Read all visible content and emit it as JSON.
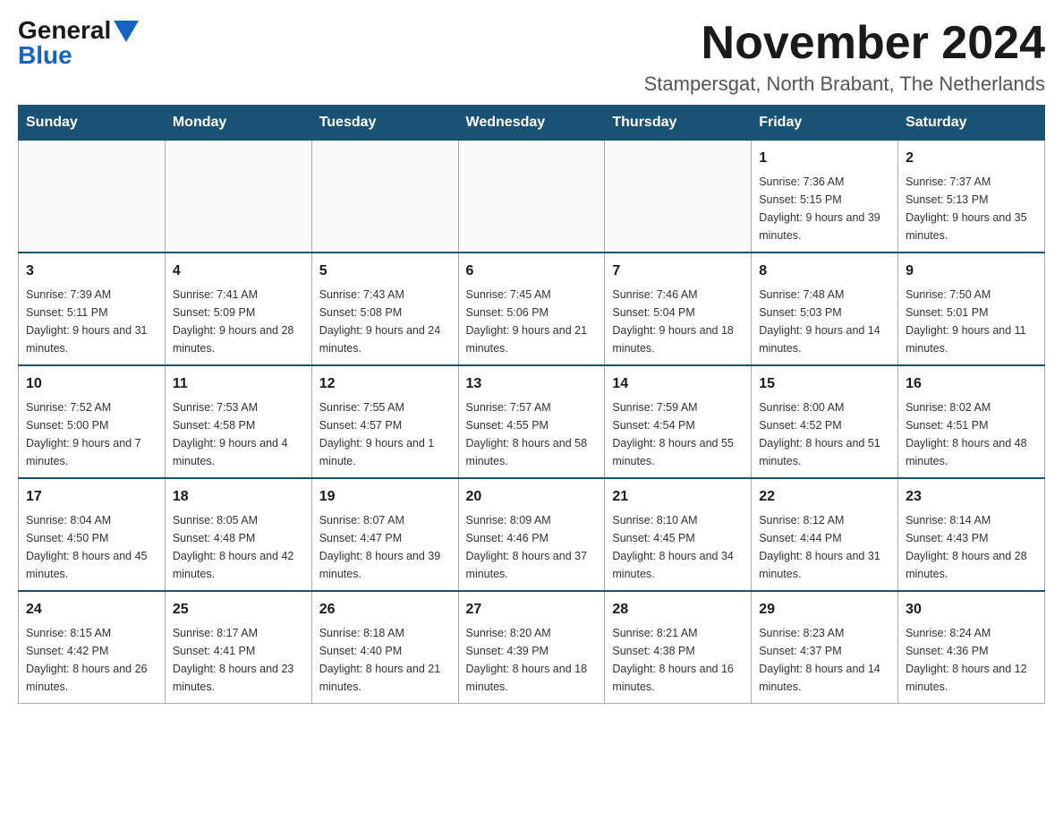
{
  "logo": {
    "general": "General",
    "blue": "Blue"
  },
  "title": "November 2024",
  "location": "Stampersgat, North Brabant, The Netherlands",
  "days_of_week": [
    "Sunday",
    "Monday",
    "Tuesday",
    "Wednesday",
    "Thursday",
    "Friday",
    "Saturday"
  ],
  "weeks": [
    [
      {
        "day": "",
        "sunrise": "",
        "sunset": "",
        "daylight": ""
      },
      {
        "day": "",
        "sunrise": "",
        "sunset": "",
        "daylight": ""
      },
      {
        "day": "",
        "sunrise": "",
        "sunset": "",
        "daylight": ""
      },
      {
        "day": "",
        "sunrise": "",
        "sunset": "",
        "daylight": ""
      },
      {
        "day": "",
        "sunrise": "",
        "sunset": "",
        "daylight": ""
      },
      {
        "day": "1",
        "sunrise": "Sunrise: 7:36 AM",
        "sunset": "Sunset: 5:15 PM",
        "daylight": "Daylight: 9 hours and 39 minutes."
      },
      {
        "day": "2",
        "sunrise": "Sunrise: 7:37 AM",
        "sunset": "Sunset: 5:13 PM",
        "daylight": "Daylight: 9 hours and 35 minutes."
      }
    ],
    [
      {
        "day": "3",
        "sunrise": "Sunrise: 7:39 AM",
        "sunset": "Sunset: 5:11 PM",
        "daylight": "Daylight: 9 hours and 31 minutes."
      },
      {
        "day": "4",
        "sunrise": "Sunrise: 7:41 AM",
        "sunset": "Sunset: 5:09 PM",
        "daylight": "Daylight: 9 hours and 28 minutes."
      },
      {
        "day": "5",
        "sunrise": "Sunrise: 7:43 AM",
        "sunset": "Sunset: 5:08 PM",
        "daylight": "Daylight: 9 hours and 24 minutes."
      },
      {
        "day": "6",
        "sunrise": "Sunrise: 7:45 AM",
        "sunset": "Sunset: 5:06 PM",
        "daylight": "Daylight: 9 hours and 21 minutes."
      },
      {
        "day": "7",
        "sunrise": "Sunrise: 7:46 AM",
        "sunset": "Sunset: 5:04 PM",
        "daylight": "Daylight: 9 hours and 18 minutes."
      },
      {
        "day": "8",
        "sunrise": "Sunrise: 7:48 AM",
        "sunset": "Sunset: 5:03 PM",
        "daylight": "Daylight: 9 hours and 14 minutes."
      },
      {
        "day": "9",
        "sunrise": "Sunrise: 7:50 AM",
        "sunset": "Sunset: 5:01 PM",
        "daylight": "Daylight: 9 hours and 11 minutes."
      }
    ],
    [
      {
        "day": "10",
        "sunrise": "Sunrise: 7:52 AM",
        "sunset": "Sunset: 5:00 PM",
        "daylight": "Daylight: 9 hours and 7 minutes."
      },
      {
        "day": "11",
        "sunrise": "Sunrise: 7:53 AM",
        "sunset": "Sunset: 4:58 PM",
        "daylight": "Daylight: 9 hours and 4 minutes."
      },
      {
        "day": "12",
        "sunrise": "Sunrise: 7:55 AM",
        "sunset": "Sunset: 4:57 PM",
        "daylight": "Daylight: 9 hours and 1 minute."
      },
      {
        "day": "13",
        "sunrise": "Sunrise: 7:57 AM",
        "sunset": "Sunset: 4:55 PM",
        "daylight": "Daylight: 8 hours and 58 minutes."
      },
      {
        "day": "14",
        "sunrise": "Sunrise: 7:59 AM",
        "sunset": "Sunset: 4:54 PM",
        "daylight": "Daylight: 8 hours and 55 minutes."
      },
      {
        "day": "15",
        "sunrise": "Sunrise: 8:00 AM",
        "sunset": "Sunset: 4:52 PM",
        "daylight": "Daylight: 8 hours and 51 minutes."
      },
      {
        "day": "16",
        "sunrise": "Sunrise: 8:02 AM",
        "sunset": "Sunset: 4:51 PM",
        "daylight": "Daylight: 8 hours and 48 minutes."
      }
    ],
    [
      {
        "day": "17",
        "sunrise": "Sunrise: 8:04 AM",
        "sunset": "Sunset: 4:50 PM",
        "daylight": "Daylight: 8 hours and 45 minutes."
      },
      {
        "day": "18",
        "sunrise": "Sunrise: 8:05 AM",
        "sunset": "Sunset: 4:48 PM",
        "daylight": "Daylight: 8 hours and 42 minutes."
      },
      {
        "day": "19",
        "sunrise": "Sunrise: 8:07 AM",
        "sunset": "Sunset: 4:47 PM",
        "daylight": "Daylight: 8 hours and 39 minutes."
      },
      {
        "day": "20",
        "sunrise": "Sunrise: 8:09 AM",
        "sunset": "Sunset: 4:46 PM",
        "daylight": "Daylight: 8 hours and 37 minutes."
      },
      {
        "day": "21",
        "sunrise": "Sunrise: 8:10 AM",
        "sunset": "Sunset: 4:45 PM",
        "daylight": "Daylight: 8 hours and 34 minutes."
      },
      {
        "day": "22",
        "sunrise": "Sunrise: 8:12 AM",
        "sunset": "Sunset: 4:44 PM",
        "daylight": "Daylight: 8 hours and 31 minutes."
      },
      {
        "day": "23",
        "sunrise": "Sunrise: 8:14 AM",
        "sunset": "Sunset: 4:43 PM",
        "daylight": "Daylight: 8 hours and 28 minutes."
      }
    ],
    [
      {
        "day": "24",
        "sunrise": "Sunrise: 8:15 AM",
        "sunset": "Sunset: 4:42 PM",
        "daylight": "Daylight: 8 hours and 26 minutes."
      },
      {
        "day": "25",
        "sunrise": "Sunrise: 8:17 AM",
        "sunset": "Sunset: 4:41 PM",
        "daylight": "Daylight: 8 hours and 23 minutes."
      },
      {
        "day": "26",
        "sunrise": "Sunrise: 8:18 AM",
        "sunset": "Sunset: 4:40 PM",
        "daylight": "Daylight: 8 hours and 21 minutes."
      },
      {
        "day": "27",
        "sunrise": "Sunrise: 8:20 AM",
        "sunset": "Sunset: 4:39 PM",
        "daylight": "Daylight: 8 hours and 18 minutes."
      },
      {
        "day": "28",
        "sunrise": "Sunrise: 8:21 AM",
        "sunset": "Sunset: 4:38 PM",
        "daylight": "Daylight: 8 hours and 16 minutes."
      },
      {
        "day": "29",
        "sunrise": "Sunrise: 8:23 AM",
        "sunset": "Sunset: 4:37 PM",
        "daylight": "Daylight: 8 hours and 14 minutes."
      },
      {
        "day": "30",
        "sunrise": "Sunrise: 8:24 AM",
        "sunset": "Sunset: 4:36 PM",
        "daylight": "Daylight: 8 hours and 12 minutes."
      }
    ]
  ]
}
